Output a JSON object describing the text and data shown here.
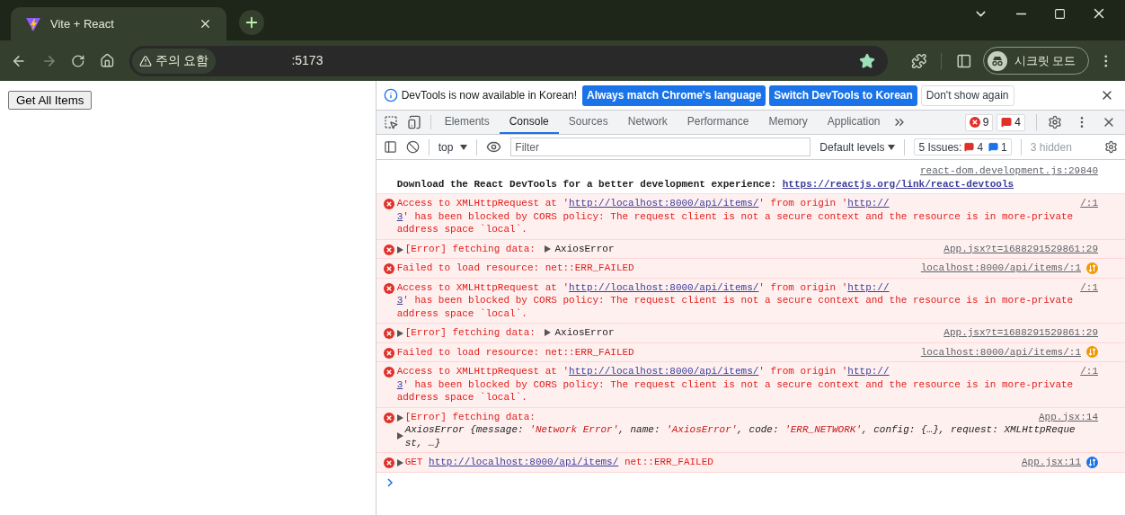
{
  "browser": {
    "tab": {
      "title": "Vite + React"
    },
    "address_bar": {
      "security_chip": "주의 요함",
      "url": ":5173"
    },
    "profile_chip": "시크릿 모드"
  },
  "page": {
    "button": "Get All Items"
  },
  "devtools": {
    "infobar": {
      "message": "DevTools is now available in Korean!",
      "buttons": [
        {
          "label": "Always match Chrome's language",
          "kind": "primary"
        },
        {
          "label": "Switch DevTools to Korean",
          "kind": "primary"
        },
        {
          "label": "Don't show again",
          "kind": "secondary"
        }
      ]
    },
    "tabs": [
      {
        "label": "Elements",
        "selected": false
      },
      {
        "label": "Console",
        "selected": true
      },
      {
        "label": "Sources",
        "selected": false
      },
      {
        "label": "Network",
        "selected": false
      },
      {
        "label": "Performance",
        "selected": false
      },
      {
        "label": "Memory",
        "selected": false
      },
      {
        "label": "Application",
        "selected": false
      }
    ],
    "error_count": "9",
    "issue_flag_count": "4",
    "console_toolbar": {
      "context": "top",
      "filter_placeholder": "Filter",
      "levels": "Default levels",
      "issues": {
        "label": "5 Issues:",
        "errors": "4",
        "infos": "1"
      },
      "hidden": "3 hidden"
    },
    "messages": [
      {
        "kind": "log",
        "source": "react-dom.development.js:29840",
        "lines": [
          [
            {
              "text": "Download the React DevTools for a better development experience: "
            },
            {
              "link": "https://reactjs.org/link/react-devtools"
            }
          ]
        ]
      },
      {
        "kind": "error",
        "source": "/:1",
        "lines": [
          [
            {
              "text": "Access to XMLHttpRequest at '"
            },
            {
              "link": "http://localhost:8000/api/items/"
            },
            {
              "text": "' from origin '"
            },
            {
              "link": "http://"
            }
          ],
          [
            {
              "link": "3"
            },
            {
              "text": "' has been blocked by CORS policy: The request client is not a secure context and the resource is in more-private"
            }
          ],
          [
            {
              "text": "address space `local`."
            }
          ]
        ]
      },
      {
        "kind": "error",
        "expandable": true,
        "source": "App.jsx?t=1688291529861:29",
        "lines": [
          [
            {
              "text": "[Error] fetching data: "
            }
          ]
        ],
        "object": {
          "label": "AxiosError",
          "expandable": true
        }
      },
      {
        "kind": "error",
        "source": "localhost:8000/api/items/:1",
        "network_icon": {
          "color": "#f29900"
        },
        "lines": [
          [
            {
              "text": "Failed to load resource: net::ERR_FAILED"
            }
          ]
        ]
      },
      {
        "kind": "error",
        "source": "/:1",
        "lines": [
          [
            {
              "text": "Access to XMLHttpRequest at '"
            },
            {
              "link": "http://localhost:8000/api/items/"
            },
            {
              "text": "' from origin '"
            },
            {
              "link": "http://"
            }
          ],
          [
            {
              "link": "3"
            },
            {
              "text": "' has been blocked by CORS policy: The request client is not a secure context and the resource is in more-private"
            }
          ],
          [
            {
              "text": "address space `local`."
            }
          ]
        ]
      },
      {
        "kind": "error",
        "expandable": true,
        "source": "App.jsx?t=1688291529861:29",
        "lines": [
          [
            {
              "text": "[Error] fetching data: "
            }
          ]
        ],
        "object": {
          "label": "AxiosError",
          "expandable": true
        }
      },
      {
        "kind": "error",
        "source": "localhost:8000/api/items/:1",
        "network_icon": {
          "color": "#f29900"
        },
        "lines": [
          [
            {
              "text": "Failed to load resource: net::ERR_FAILED"
            }
          ]
        ]
      },
      {
        "kind": "error",
        "source": "/:1",
        "lines": [
          [
            {
              "text": "Access to XMLHttpRequest at '"
            },
            {
              "link": "http://localhost:8000/api/items/"
            },
            {
              "text": "' from origin '"
            },
            {
              "link": "http://"
            }
          ],
          [
            {
              "link": "3"
            },
            {
              "text": "' has been blocked by CORS policy: The request client is not a secure context and the resource is in more-private"
            }
          ],
          [
            {
              "text": "address space `local`."
            }
          ]
        ]
      },
      {
        "kind": "error",
        "expandable": true,
        "source": "App.jsx:14",
        "lines": [
          [
            {
              "text": "[Error] fetching data:"
            }
          ]
        ],
        "detail": {
          "expandable": true,
          "lines": [
            [
              {
                "text": "AxiosError {message: "
              },
              {
                "string": "'Network Error'"
              },
              {
                "text": ", name: "
              },
              {
                "string": "'AxiosError'"
              },
              {
                "text": ", code: "
              },
              {
                "string": "'ERR_NETWORK'"
              },
              {
                "text": ", config: {…}, request: XMLHttpReque"
              }
            ],
            [
              {
                "text": "st, …}"
              }
            ]
          ]
        }
      },
      {
        "kind": "error",
        "expandable": true,
        "source": "App.jsx:11",
        "network_icon": {
          "color": "#1a73e8"
        },
        "lines": [
          [
            {
              "text": "GET "
            },
            {
              "link": "http://localhost:8000/api/items/"
            },
            {
              "text": " net::ERR_FAILED"
            }
          ]
        ]
      }
    ]
  }
}
